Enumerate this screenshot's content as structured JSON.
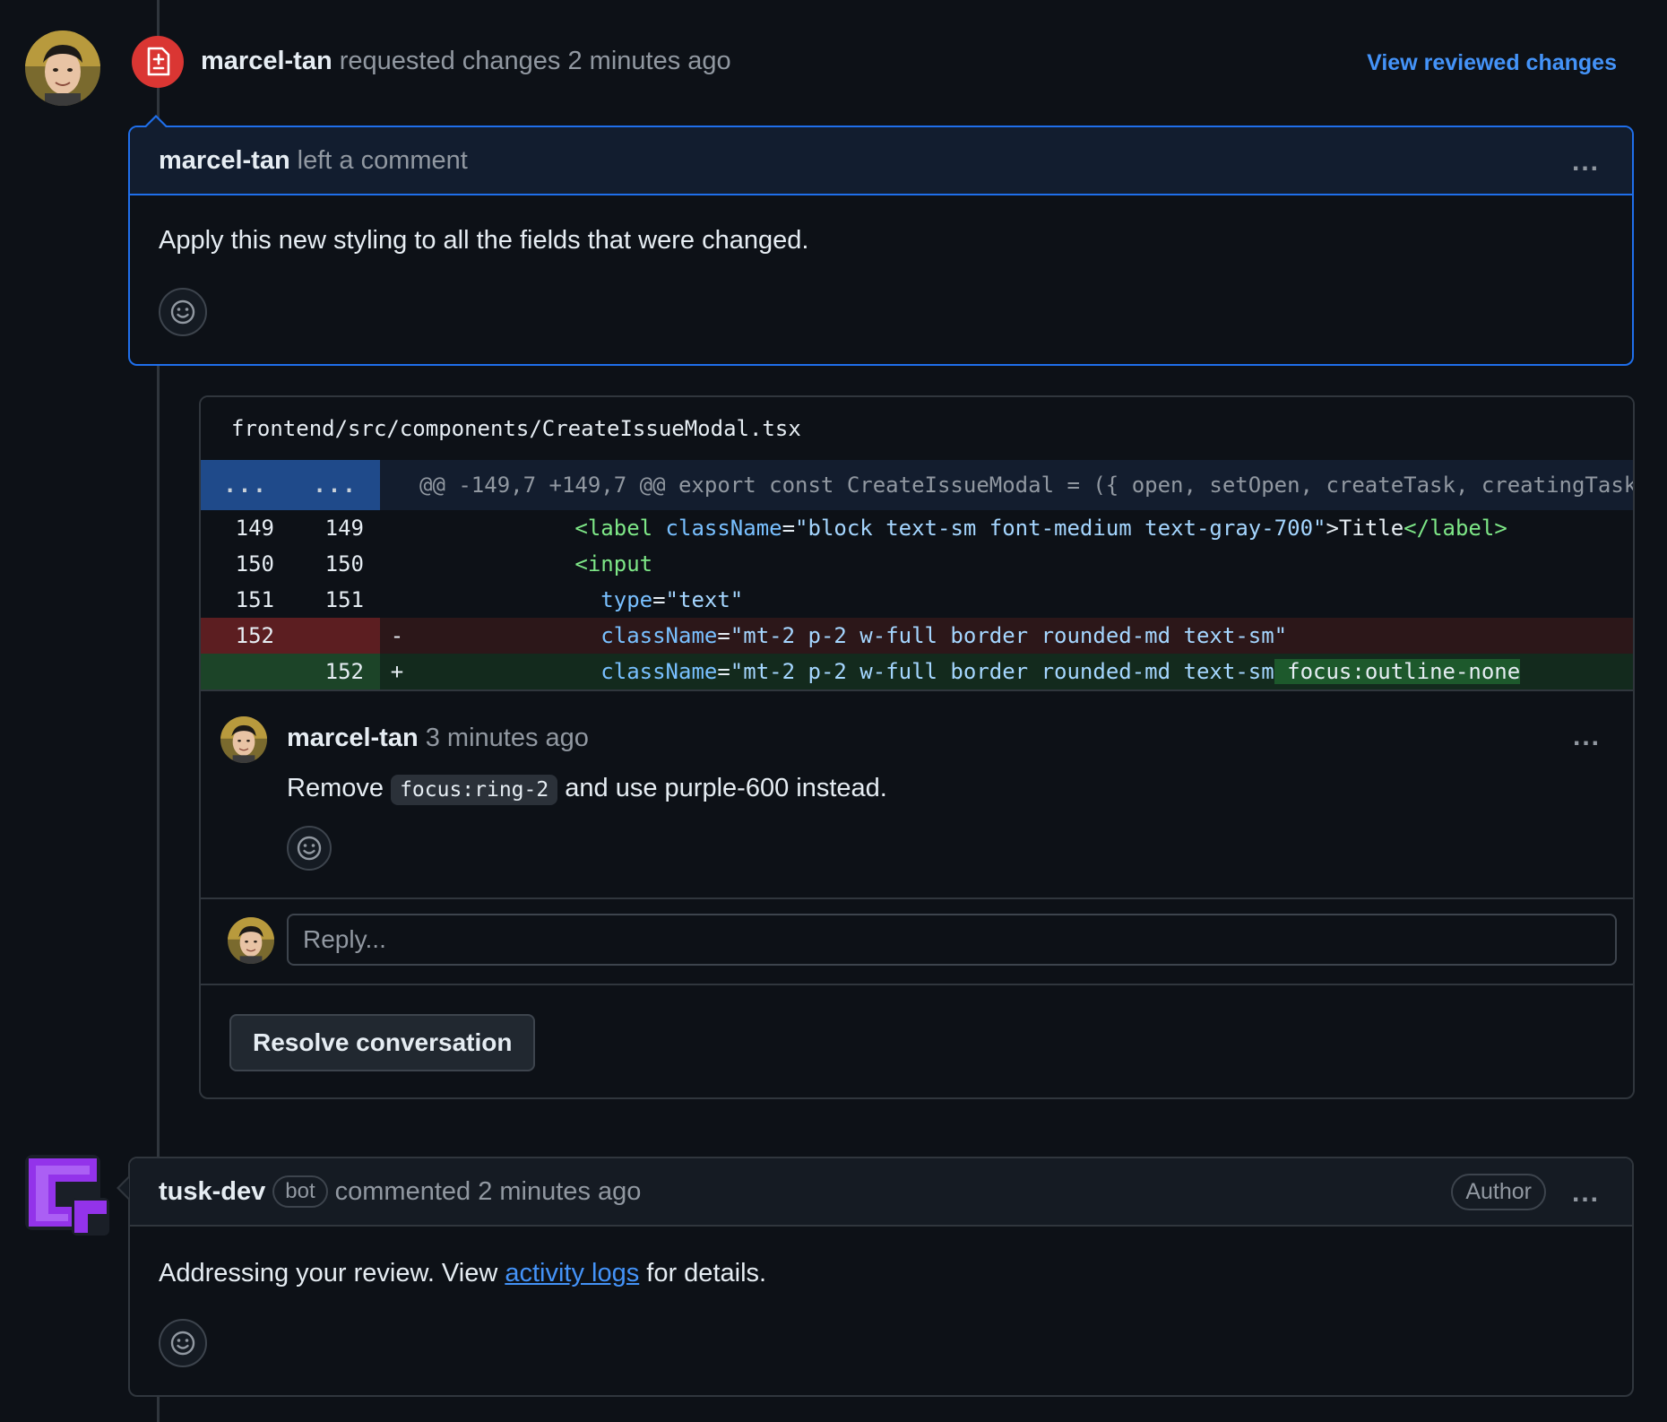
{
  "review": {
    "author": "marcel-tan",
    "action": "requested changes",
    "time": "2 minutes ago",
    "view_link": "View reviewed changes",
    "comment_author": "marcel-tan",
    "comment_action": "left a comment",
    "comment_body": "Apply this new styling to all the fields that were changed.",
    "more_label": "..."
  },
  "file": {
    "path": "frontend/src/components/CreateIssueModal.tsx",
    "hunk_gutter_left": "...",
    "hunk_gutter_right": "...",
    "hunk_header": "@@ -149,7 +149,7 @@ export const CreateIssueModal = ({ open, setOpen, createTask, creatingTask",
    "lines": [
      {
        "old": "149",
        "new": "149",
        "sign": "",
        "indent": "            ",
        "parts": [
          [
            "tk-angle",
            "<"
          ],
          [
            "tk-tag",
            "label"
          ],
          [
            "tk-plain",
            " "
          ],
          [
            "tk-attr",
            "className"
          ],
          [
            "tk-plain",
            "="
          ],
          [
            "tk-str",
            "\"block text-sm font-medium text-gray-700\""
          ],
          [
            "tk-plain",
            ">Title"
          ],
          [
            "tk-angle",
            "</"
          ],
          [
            "tk-tag",
            "label"
          ],
          [
            "tk-angle",
            ">"
          ]
        ]
      },
      {
        "old": "150",
        "new": "150",
        "sign": "",
        "indent": "            ",
        "parts": [
          [
            "tk-angle",
            "<"
          ],
          [
            "tk-tag",
            "input"
          ]
        ]
      },
      {
        "old": "151",
        "new": "151",
        "sign": "",
        "indent": "              ",
        "parts": [
          [
            "tk-attr",
            "type"
          ],
          [
            "tk-plain",
            "="
          ],
          [
            "tk-str",
            "\"text\""
          ]
        ]
      },
      {
        "old": "152",
        "new": "",
        "sign": "-",
        "indent": "              ",
        "parts": [
          [
            "tk-attr",
            "className"
          ],
          [
            "tk-plain",
            "="
          ],
          [
            "tk-str",
            "\"mt-2 p-2 w-full border rounded-md text-sm\""
          ]
        ]
      },
      {
        "old": "",
        "new": "152",
        "sign": "+",
        "indent": "              ",
        "parts": [
          [
            "tk-attr",
            "className"
          ],
          [
            "tk-plain",
            "="
          ],
          [
            "tk-str",
            "\"mt-2 p-2 w-full border rounded-md text-sm"
          ],
          [
            "add-hl",
            " focus:outline-none"
          ]
        ]
      }
    ]
  },
  "thread": {
    "author": "marcel-tan",
    "time": "3 minutes ago",
    "body_before": "Remove",
    "code": "focus:ring-2",
    "body_after": "and use purple-600 instead.",
    "reply_placeholder": "Reply...",
    "resolve_label": "Resolve conversation"
  },
  "bot": {
    "author": "tusk-dev",
    "badge": "bot",
    "action": "commented 2 minutes ago",
    "author_badge": "Author",
    "body_before": "Addressing your review. View",
    "link_text": "activity logs",
    "body_after": "for details."
  },
  "colors": {
    "background": "#0d1117",
    "accent_blue": "#4493f8",
    "request_changes_red": "#da3633",
    "bot_purple": "#9333ea"
  },
  "icons": {
    "review_badge": "file-diff-icon",
    "emoji": "smiley-icon",
    "more": "kebab-horizontal-icon"
  }
}
